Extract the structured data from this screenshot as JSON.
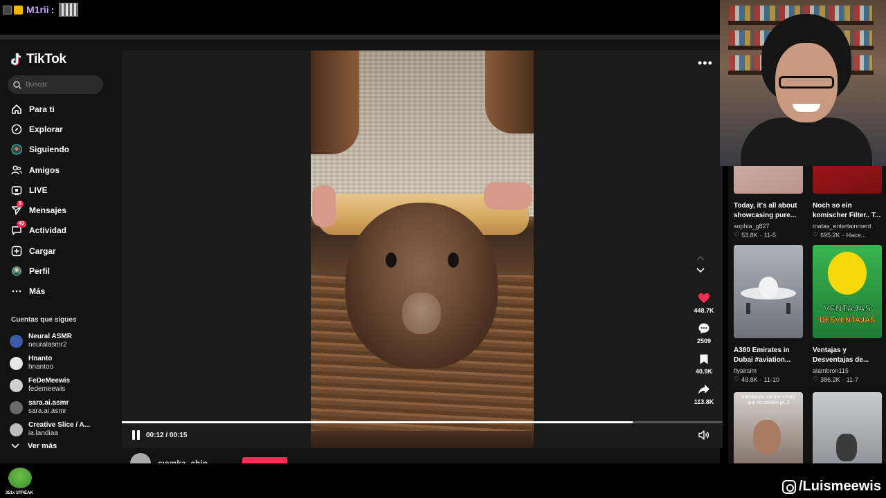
{
  "stream": {
    "chat_user": "M1rii",
    "chat_separator": ":",
    "streak_label": "351x STREAK",
    "instagram_handle": "/Luismeewis"
  },
  "tiktok": {
    "logo_text": "TikTok",
    "search_placeholder": "Buscar",
    "nav": [
      {
        "label": "Para ti",
        "icon": "home-icon"
      },
      {
        "label": "Explorar",
        "icon": "compass-icon"
      },
      {
        "label": "Siguiendo",
        "icon": "following-avatar-icon"
      },
      {
        "label": "Amigos",
        "icon": "friends-icon"
      },
      {
        "label": "LIVE",
        "icon": "live-icon"
      },
      {
        "label": "Mensajes",
        "icon": "send-icon",
        "badge": "5"
      },
      {
        "label": "Actividad",
        "icon": "message-icon",
        "badge": "43"
      },
      {
        "label": "Cargar",
        "icon": "plus-square-icon"
      },
      {
        "label": "Perfil",
        "icon": "avatar-icon"
      },
      {
        "label": "Más",
        "icon": "more-horizontal-icon"
      }
    ],
    "following_title": "Cuentas que sigues",
    "following": [
      {
        "name": "Neural ASMR",
        "handle": "neuralasmr2",
        "color": "#3b5ba8"
      },
      {
        "name": "Hnanto",
        "handle": "hnantoo",
        "color": "#e8e8e8"
      },
      {
        "name": "FeDeMeewis",
        "handle": "fedemeewis",
        "color": "#cfcfcf"
      },
      {
        "name": "sara.ai.asmr",
        "handle": "sara.ai.asmr",
        "color": "#6a6a6a"
      },
      {
        "name": "Creative Slice / A...",
        "handle": "ia.landiaa",
        "color": "#bdbdbd"
      }
    ],
    "ver_mas": "Ver más",
    "video": {
      "time": "00:12 / 00:15",
      "progress": 0.85,
      "likes": "448.7K",
      "comments": "2509",
      "saves": "40.9K",
      "shares": "113.8K",
      "author": "syynka_chip"
    },
    "grid": [
      {
        "title": "Today, it's all about",
        "subtitle": "showcasing pure...",
        "author": "sophia_g827",
        "likes": "53.8K",
        "date": "11-5",
        "thumb": "#b8948a"
      },
      {
        "title": "Noch so ein",
        "subtitle": "komischer Filter.. T...",
        "author": "matas_entertainment",
        "likes": "695.2K",
        "date": "Hace...",
        "thumb": "#c01b1b"
      },
      {
        "title": "A380 Emirates in",
        "subtitle": "Dubai #aviation...",
        "author": "flyairsim",
        "likes": "49.8K",
        "date": "11-10",
        "thumb": "#8b8e96"
      },
      {
        "title": "Ventajas y",
        "subtitle": "Desventajas de...",
        "author": "alambron115",
        "likes": "386.2K",
        "date": "11-7",
        "thumb": "#2da04a"
      },
      {
        "title": "",
        "subtitle": "",
        "author": "",
        "likes": "",
        "date": "",
        "thumb": "#6b5a50",
        "overlay": "intentando vender cosas que no existen pt. 2"
      },
      {
        "title": "",
        "subtitle": "",
        "author": "",
        "likes": "",
        "date": "",
        "thumb": "#9aa0a6"
      }
    ],
    "grid_overlay_ventajas": "VENTAJAS",
    "grid_overlay_desventajas": "DESVENTAJAS"
  }
}
